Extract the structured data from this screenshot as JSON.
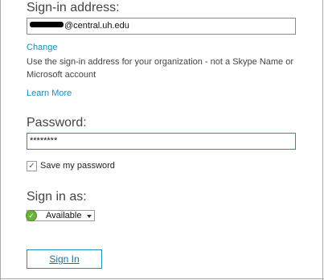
{
  "signin": {
    "heading": "Sign-in address:",
    "address_value": "@central.uh.edu",
    "change_link": "Change",
    "hint": "Use the sign-in address for your organization - not a Skype Name or Microsoft account",
    "learn_more": "Learn More"
  },
  "password": {
    "heading": "Password:",
    "value": "********",
    "save_label": "Save my password",
    "save_checked": true
  },
  "sign_in_as": {
    "heading": "Sign in as:",
    "status": "Available",
    "status_color": "#6cb33e"
  },
  "actions": {
    "sign_in_button": "Sign In"
  },
  "colors": {
    "accent": "#1c8fb8",
    "field_focus_border": "#1f8fb7"
  }
}
